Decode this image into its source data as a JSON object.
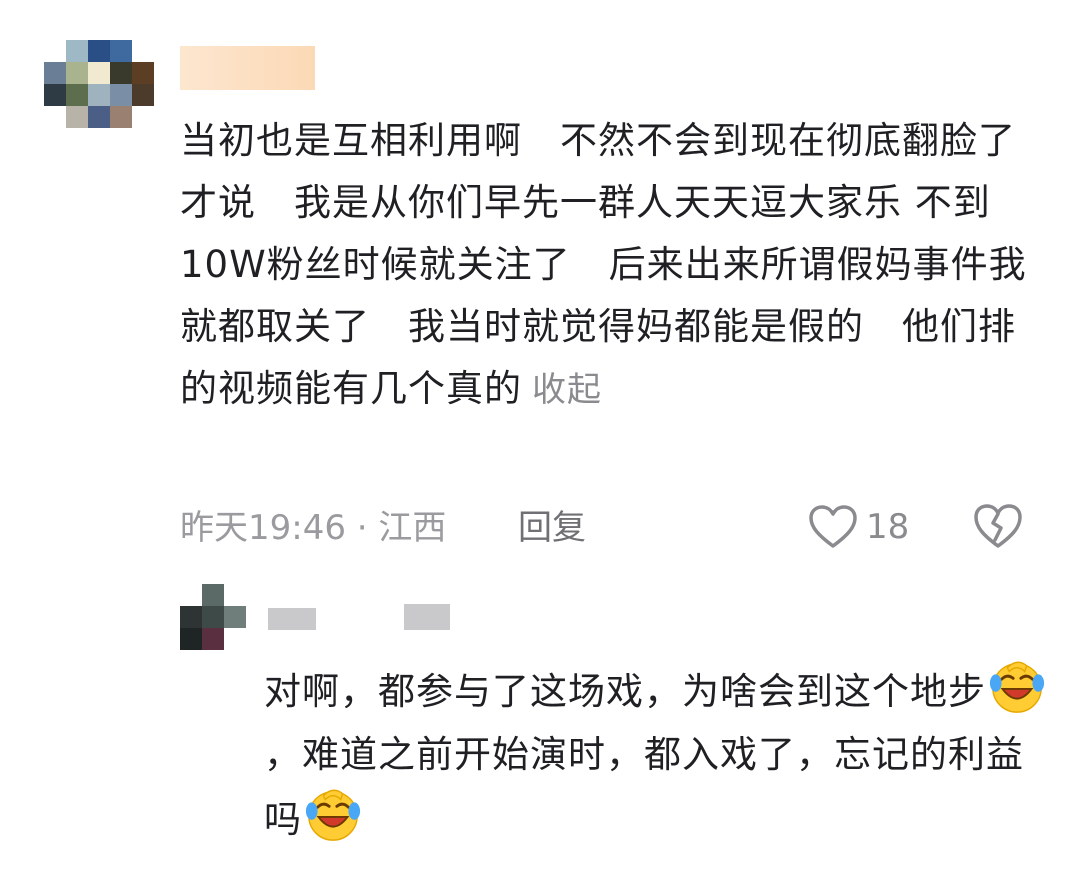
{
  "comment": {
    "text": "当初也是互相利用啊　不然不会到现在彻底翻脸了才说　我是从你们早先一群人天天逗大家乐 不到10W粉丝时候就关注了　后来出来所谓假妈事件我就都取关了　我当时就觉得妈都能是假的　他们排的视频能有几个真的",
    "collapse_label": "收起",
    "meta": "昨天19:46 · 江西",
    "reply_label": "回复",
    "like_count": "18",
    "icons": [
      "heart-outline-icon",
      "broken-heart-icon"
    ]
  },
  "reply": {
    "text_part1": "对啊，都参与了这场戏，为啥会到这个地步",
    "text_part2": "，难道之前开始演时，都入戏了，忘记的利益吗",
    "emoji": "face-with-tears-of-joy-emoji"
  }
}
